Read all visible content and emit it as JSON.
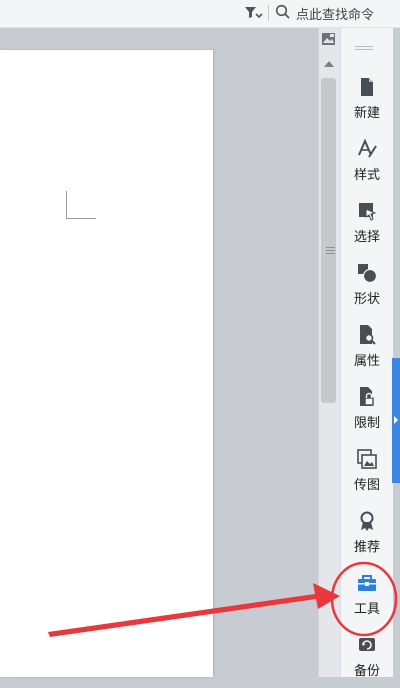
{
  "toolbar": {
    "search_placeholder": "点此查找命令",
    "filter_icon": "filter-icon",
    "search_icon": "search-icon"
  },
  "panel": {
    "tools": [
      {
        "label": "新建",
        "icon": "new-document-icon"
      },
      {
        "label": "样式",
        "icon": "text-style-icon"
      },
      {
        "label": "选择",
        "icon": "select-cursor-icon"
      },
      {
        "label": "形状",
        "icon": "shapes-icon"
      },
      {
        "label": "属性",
        "icon": "properties-icon"
      },
      {
        "label": "限制",
        "icon": "restrict-lock-icon"
      },
      {
        "label": "传图",
        "icon": "upload-image-icon"
      },
      {
        "label": "推荐",
        "icon": "recommend-ribbon-icon"
      },
      {
        "label": "工具",
        "icon": "toolbox-icon"
      },
      {
        "label": "备份",
        "icon": "backup-icon"
      }
    ]
  },
  "colors": {
    "accent": "#3b86e0",
    "annotation": "#e8383d",
    "toolbox_icon": "#2e7fd6"
  }
}
